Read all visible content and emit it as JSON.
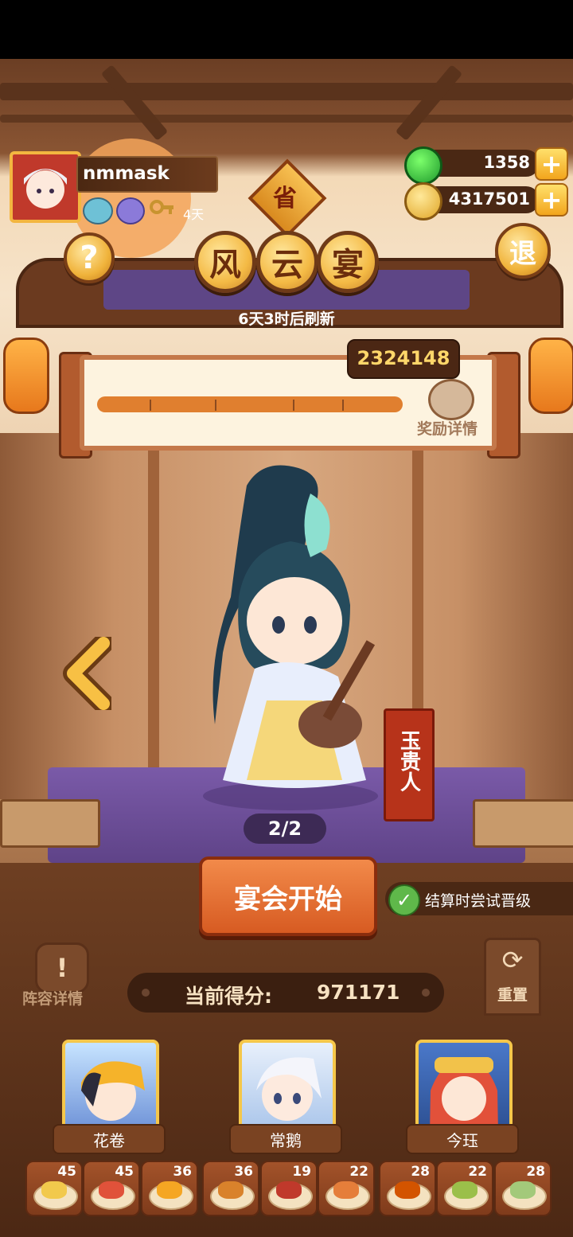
{
  "player": {
    "name": "nmmask",
    "days": "4天"
  },
  "currency": {
    "jade": "1358",
    "coins": "4317501"
  },
  "region_badge": "省",
  "title_chars": [
    "风",
    "云",
    "宴"
  ],
  "refresh_text": "6天3时后刷新",
  "exit_label": "退",
  "help_label": "?",
  "progress": {
    "score_badge": "2324148",
    "reward_label": "奖励详情",
    "fill": 1.0
  },
  "character": {
    "name": "玉贵人",
    "page": "2/2"
  },
  "start_button": "宴会开始",
  "promote_option": {
    "label": "结算时尝试晋级",
    "checked": true
  },
  "lineup_label": "阵容详情",
  "reset_label": "重置",
  "score": {
    "label": "当前得分:",
    "value": "971171"
  },
  "team": [
    {
      "name": "花卷"
    },
    {
      "name": "常鹅"
    },
    {
      "name": "今珏"
    }
  ],
  "dishes": [
    {
      "count": "45",
      "color": "#f2c94c"
    },
    {
      "count": "45",
      "color": "#e0523a"
    },
    {
      "count": "36",
      "color": "#f5a623"
    },
    {
      "count": "36",
      "color": "#d9822b"
    },
    {
      "count": "19",
      "color": "#c0392b"
    },
    {
      "count": "22",
      "color": "#e57e3a"
    },
    {
      "count": "28",
      "color": "#d35400"
    },
    {
      "count": "22",
      "color": "#9bbf4a"
    },
    {
      "count": "28",
      "color": "#a3c97a"
    }
  ]
}
